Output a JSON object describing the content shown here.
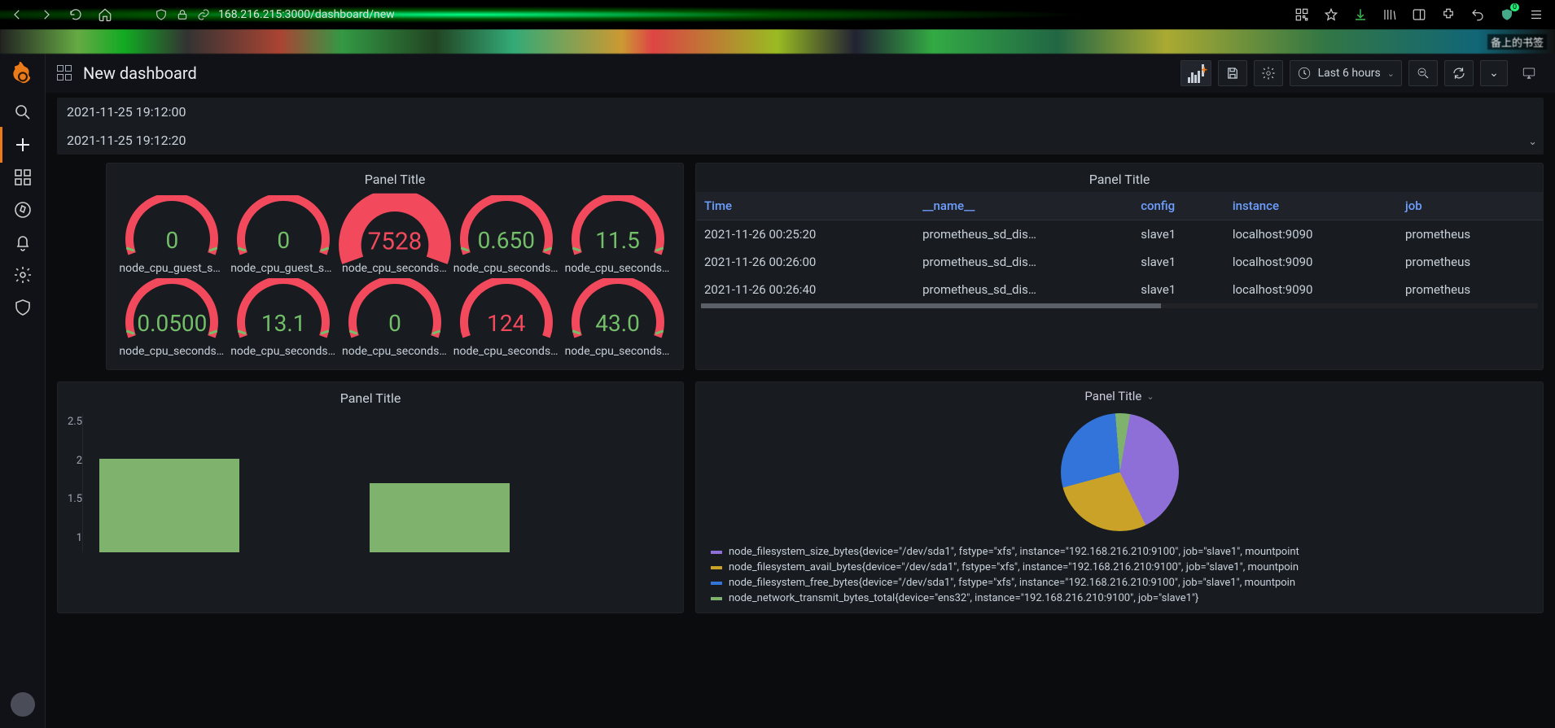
{
  "browser": {
    "url_partial": "168.216.215:3000/dashboard/new",
    "cn_label": "备上的书签",
    "badge": "0"
  },
  "topbar": {
    "title": "New dashboard",
    "time_label": "Last 6 hours"
  },
  "timestamps": [
    "2021-11-25 19:12:00",
    "2021-11-25 19:12:20"
  ],
  "gauge_panel": {
    "title": "Panel Title",
    "gauges": [
      {
        "value": "0",
        "color": "green",
        "label": "node_cpu_guest_se…",
        "fill": 0
      },
      {
        "value": "0",
        "color": "green",
        "label": "node_cpu_guest_se…",
        "fill": 0
      },
      {
        "value": "7528",
        "color": "red",
        "label": "node_cpu_seconds_…",
        "fill": 1,
        "big": true
      },
      {
        "value": "0.650",
        "color": "green",
        "label": "node_cpu_seconds_…",
        "fill": 0
      },
      {
        "value": "11.5",
        "color": "green",
        "label": "node_cpu_seconds_…",
        "fill": 0
      },
      {
        "value": "0.0500",
        "color": "green",
        "label": "node_cpu_seconds_…",
        "fill": 0
      },
      {
        "value": "13.1",
        "color": "green",
        "label": "node_cpu_seconds_…",
        "fill": 0
      },
      {
        "value": "0",
        "color": "green",
        "label": "node_cpu_seconds_…",
        "fill": 0
      },
      {
        "value": "124",
        "color": "red",
        "label": "node_cpu_seconds_…",
        "fill": 0.02
      },
      {
        "value": "43.0",
        "color": "green",
        "label": "node_cpu_seconds_…",
        "fill": 0
      }
    ]
  },
  "table_panel": {
    "title": "Panel Title",
    "columns": [
      "Time",
      "__name__",
      "config",
      "instance",
      "job"
    ],
    "rows": [
      [
        "2021-11-26 00:25:20",
        "prometheus_sd_dis…",
        "slave1",
        "localhost:9090",
        "prometheus"
      ],
      [
        "2021-11-26 00:26:00",
        "prometheus_sd_dis…",
        "slave1",
        "localhost:9090",
        "prometheus"
      ],
      [
        "2021-11-26 00:26:40",
        "prometheus_sd_dis…",
        "slave1",
        "localhost:9090",
        "prometheus"
      ]
    ]
  },
  "bar_panel": {
    "title": "Panel Title"
  },
  "pie_panel": {
    "title": "Panel Title",
    "legend": [
      {
        "color": "#8e6fd8",
        "label": "node_filesystem_size_bytes{device=\"/dev/sda1\", fstype=\"xfs\", instance=\"192.168.216.210:9100\", job=\"slave1\", mountpoint"
      },
      {
        "color": "#c9a227",
        "label": "node_filesystem_avail_bytes{device=\"/dev/sda1\", fstype=\"xfs\", instance=\"192.168.216.210:9100\", job=\"slave1\", mountpoin"
      },
      {
        "color": "#3274d9",
        "label": "node_filesystem_free_bytes{device=\"/dev/sda1\", fstype=\"xfs\", instance=\"192.168.216.210:9100\", job=\"slave1\", mountpoin"
      },
      {
        "color": "#7eb26d",
        "label": "node_network_transmit_bytes_total{device=\"ens32\", instance=\"192.168.216.210:9100\", job=\"slave1\"}"
      }
    ]
  },
  "chart_data": [
    {
      "type": "bar",
      "title": "Panel Title",
      "ylim": [
        1,
        2.5
      ],
      "yticks": [
        2.5,
        2,
        1.5,
        1
      ],
      "series": [
        {
          "name": "bar",
          "values": [
            2.15,
            1.85
          ]
        }
      ]
    },
    {
      "type": "pie",
      "title": "Panel Title",
      "series": [
        {
          "name": "node_filesystem_size_bytes",
          "value": 40,
          "color": "#8e6fd8"
        },
        {
          "name": "node_filesystem_avail_bytes",
          "value": 28,
          "color": "#c9a227"
        },
        {
          "name": "node_filesystem_free_bytes",
          "value": 28,
          "color": "#3274d9"
        },
        {
          "name": "node_network_transmit_bytes_total",
          "value": 4,
          "color": "#7eb26d"
        }
      ]
    }
  ]
}
